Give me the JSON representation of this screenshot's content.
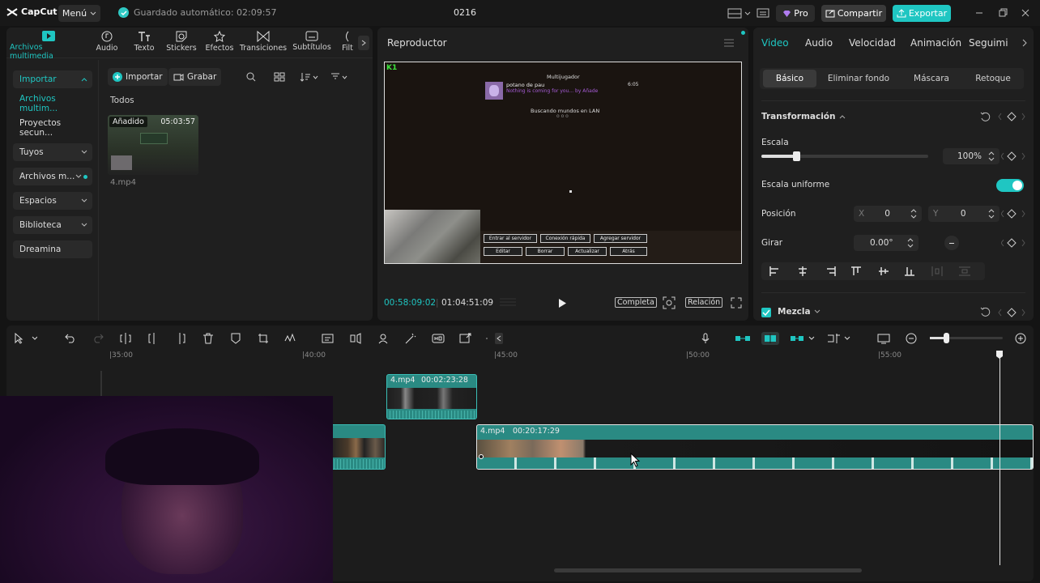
{
  "app": {
    "logo_text": "CapCut",
    "menu_label": "Menú",
    "autosave_text": "Guardado automático: 02:09:57",
    "project_name": "0216",
    "pro_label": "Pro",
    "share_label": "Compartir",
    "export_label": "Exportar",
    "accent": "#1fc6c2"
  },
  "media_tabs": [
    {
      "label": "Archivos multimedia",
      "icon": "media-icon"
    },
    {
      "label": "Audio",
      "icon": "audio-icon"
    },
    {
      "label": "Texto",
      "icon": "text-icon"
    },
    {
      "label": "Stickers",
      "icon": "sticker-icon"
    },
    {
      "label": "Efectos",
      "icon": "effects-icon"
    },
    {
      "label": "Transiciones",
      "icon": "transitions-icon"
    },
    {
      "label": "Subtítulos",
      "icon": "subtitles-icon"
    },
    {
      "label": "Filt",
      "icon": "filters-icon"
    }
  ],
  "sidebar": {
    "items": [
      {
        "label": "Importar"
      },
      {
        "label": "Archivos multim..."
      },
      {
        "label": "Proyectos secun..."
      },
      {
        "label": "Tuyos"
      },
      {
        "label": "Archivos m..."
      },
      {
        "label": "Espacios"
      },
      {
        "label": "Biblioteca"
      },
      {
        "label": "Dreamina"
      }
    ]
  },
  "media": {
    "import_label": "Importar",
    "record_label": "Grabar",
    "section_title": "Todos",
    "file": {
      "badge": "Añadido",
      "duration": "05:03:57",
      "name": "4.mp4"
    }
  },
  "player": {
    "title": "Reproductor",
    "current_time": "00:58:09:02",
    "total_time": "01:04:51:09",
    "full_label": "Completa",
    "ratio_label": "Relación",
    "game": {
      "tag": "K1",
      "header": "Multijugador",
      "server_name": "potano de pau",
      "server_ping": "6:05",
      "server_motd": "Nothing is coming for you... by Añade",
      "searching": "Buscando mundos en LAN",
      "searching_dots": "o o o",
      "buttons_row1": [
        "Entrar al servidor",
        "Conexión rápida",
        "Agregar servidor"
      ],
      "buttons_row2": [
        "Editar",
        "Borrar",
        "Actualizar",
        "Atrás"
      ]
    }
  },
  "props": {
    "tabs": [
      "Video",
      "Audio",
      "Velocidad",
      "Animación",
      "Seguimi"
    ],
    "subtabs": [
      "Básico",
      "Eliminar fondo",
      "Máscara",
      "Retoque"
    ],
    "transform_title": "Transformación",
    "scale_label": "Escala",
    "scale_value": "100%",
    "scale_slider_fraction": 0.21,
    "uniform_label": "Escala uniforme",
    "position_label": "Posición",
    "pos_x_label": "X",
    "pos_x": "0",
    "pos_y_label": "Y",
    "pos_y": "0",
    "rotate_label": "Girar",
    "rotate_value": "0.00°",
    "blend_label": "Mezcla"
  },
  "timeline": {
    "ticks": [
      "|35:00",
      "|40:00",
      "|45:00",
      "|50:00",
      "|55:00"
    ],
    "clip_upper": {
      "name": "4.mp4",
      "duration": "00:02:23:28"
    },
    "clip_main": {
      "name": "4.mp4",
      "duration": "00:20:17:29"
    }
  }
}
